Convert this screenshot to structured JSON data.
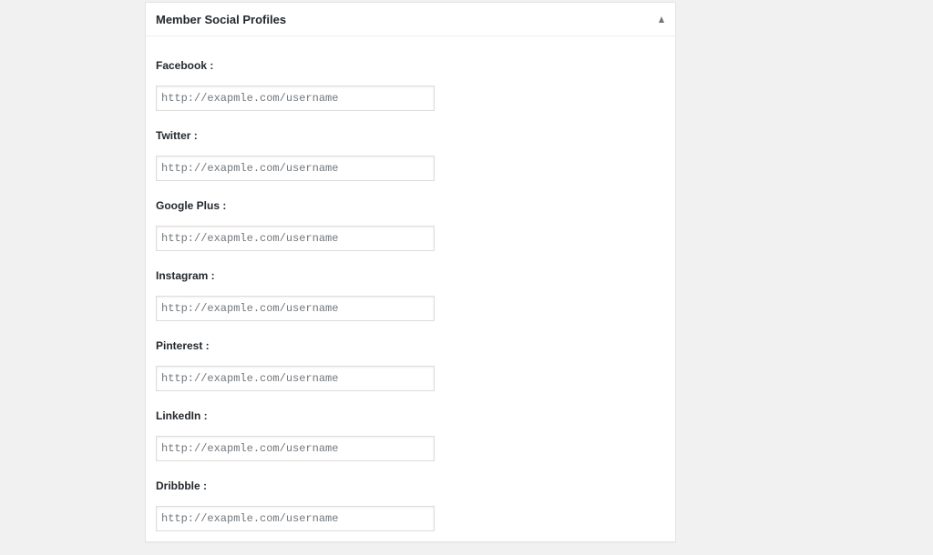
{
  "metabox": {
    "title": "Member Social Profiles",
    "toggle_icon": "triangle-up-icon"
  },
  "fields": [
    {
      "label": "Facebook :",
      "placeholder": "http://exapmle.com/username",
      "value": ""
    },
    {
      "label": "Twitter :",
      "placeholder": "http://exapmle.com/username",
      "value": ""
    },
    {
      "label": "Google Plus :",
      "placeholder": "http://exapmle.com/username",
      "value": ""
    },
    {
      "label": "Instagram :",
      "placeholder": "http://exapmle.com/username",
      "value": ""
    },
    {
      "label": "Pinterest :",
      "placeholder": "http://exapmle.com/username",
      "value": ""
    },
    {
      "label": "LinkedIn :",
      "placeholder": "http://exapmle.com/username",
      "value": ""
    },
    {
      "label": "Dribbble :",
      "placeholder": "http://exapmle.com/username",
      "value": ""
    }
  ]
}
